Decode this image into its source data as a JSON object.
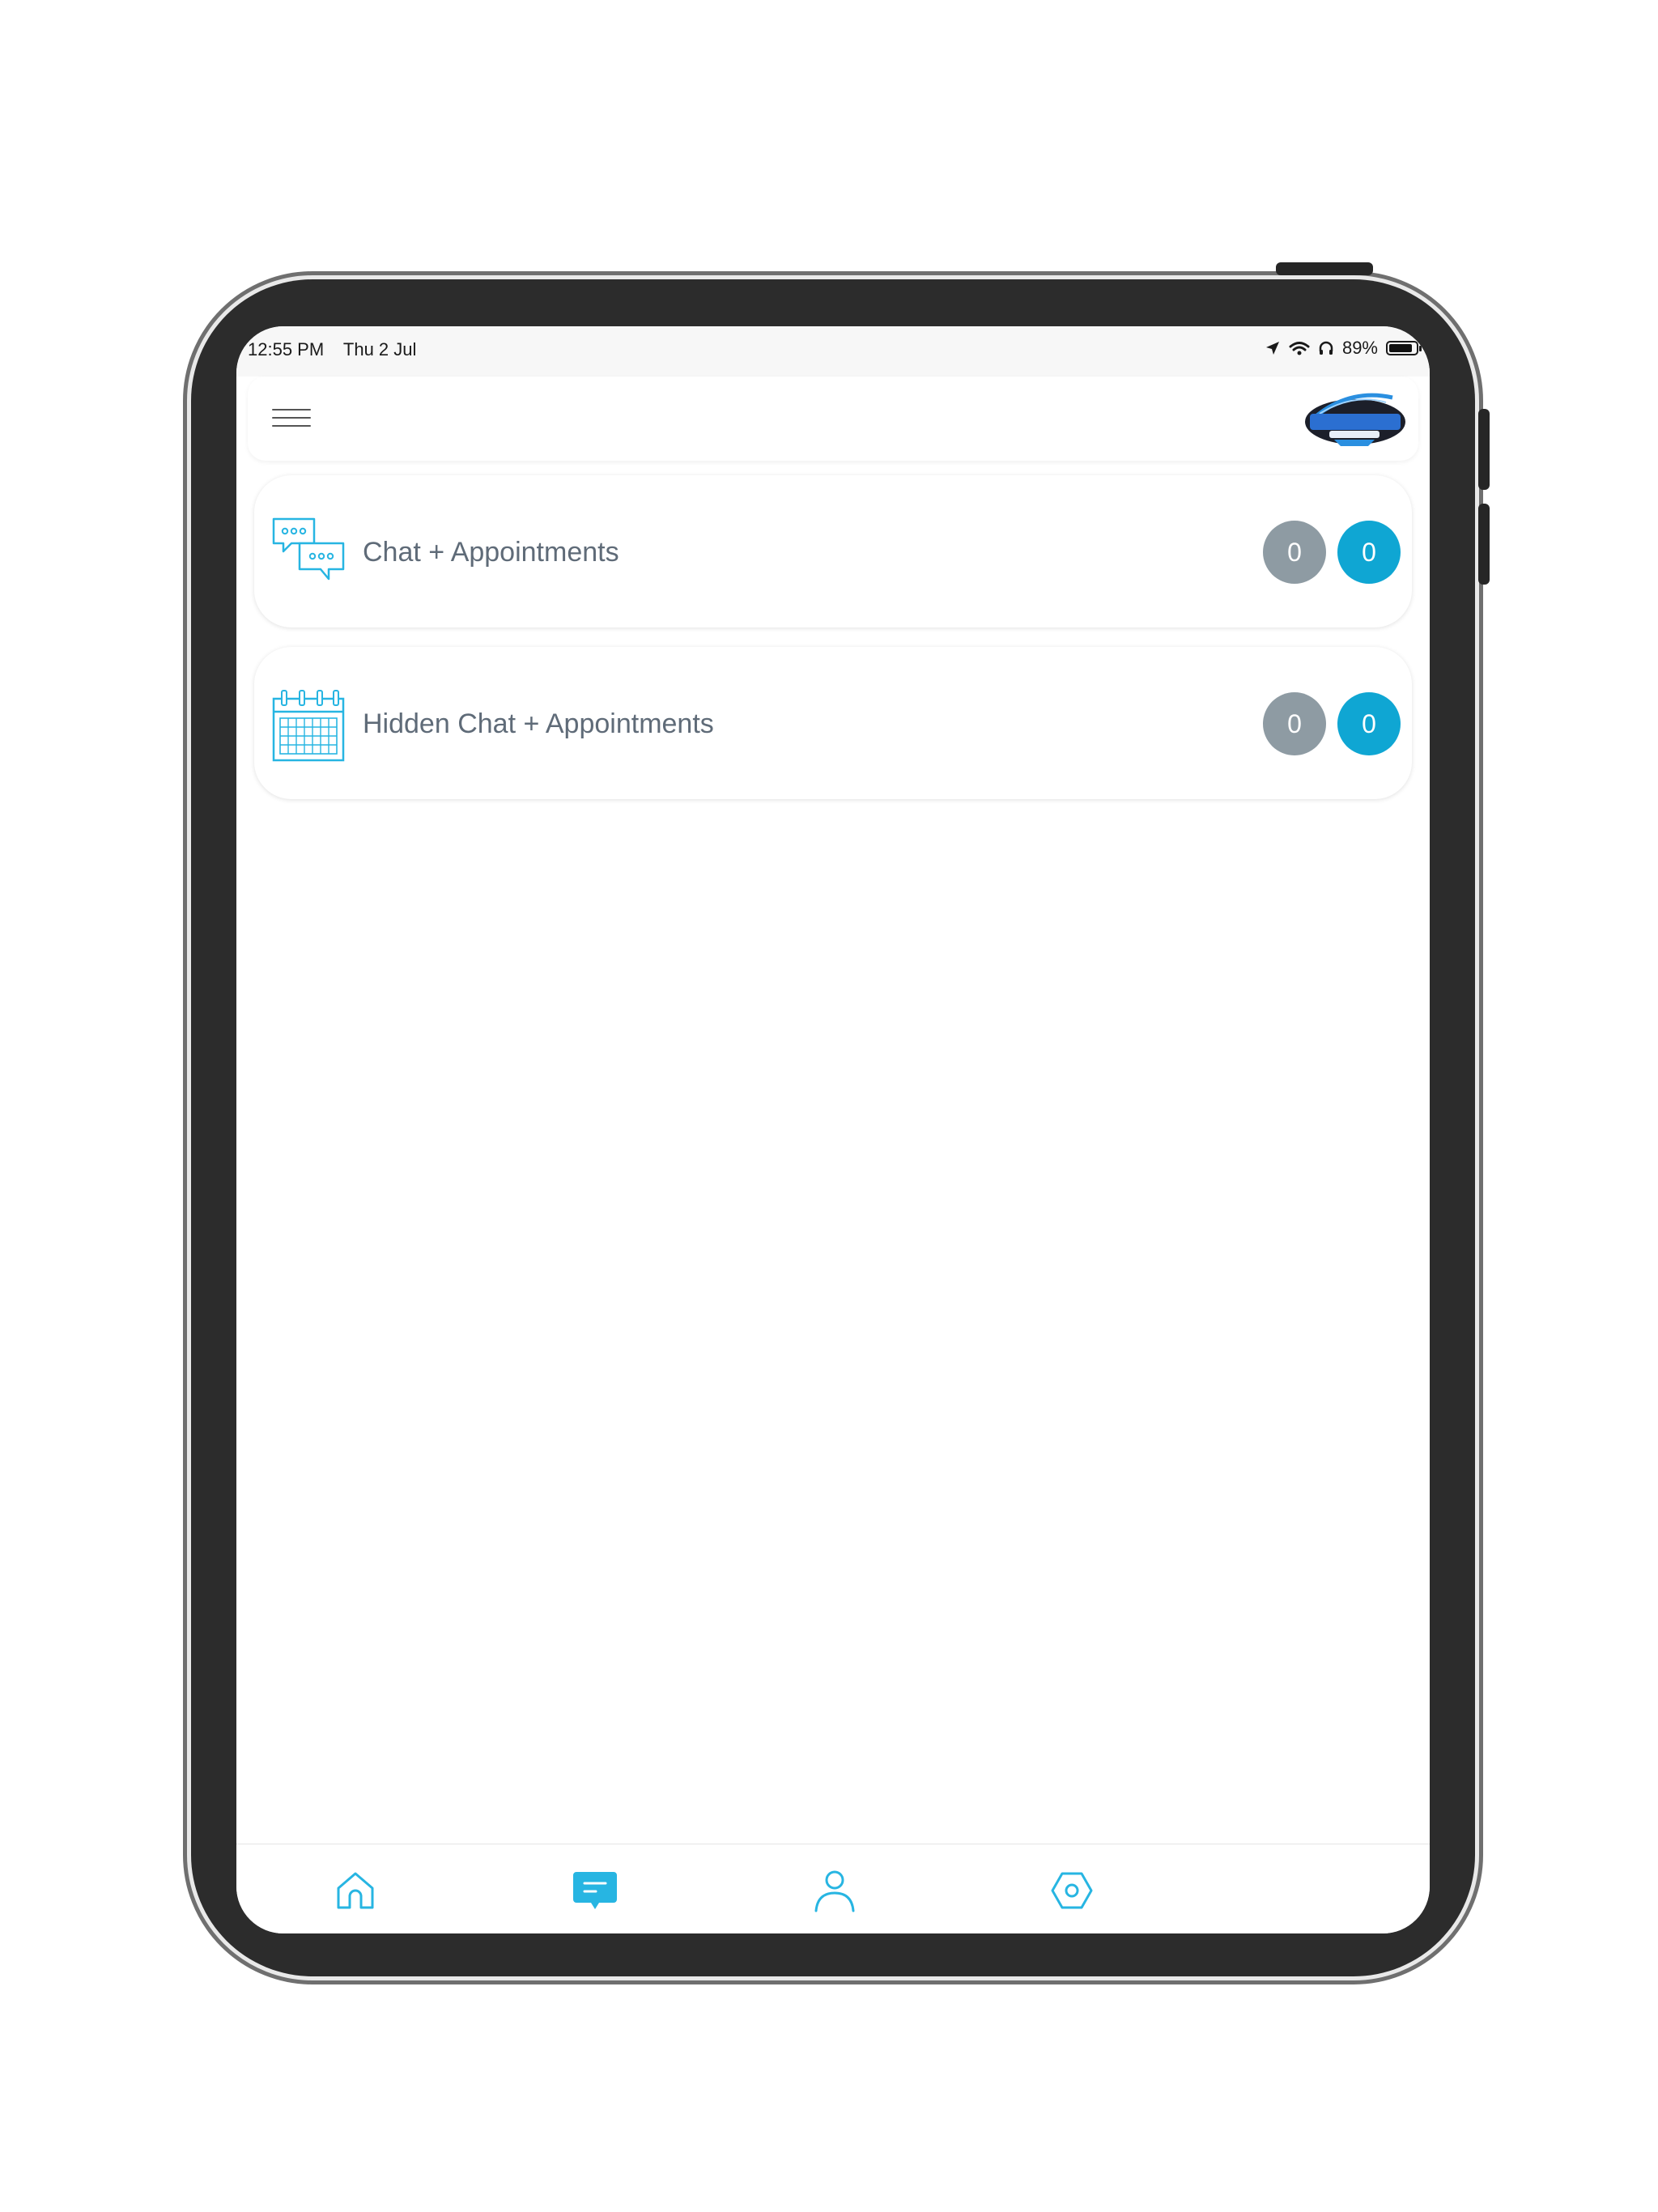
{
  "status_bar": {
    "time": "12:55 PM",
    "date": "Thu 2 Jul",
    "battery": "89%",
    "battery_level": 0.89
  },
  "header": {
    "menu_icon": "hamburger-menu-icon",
    "logo_icon": "clearway-automotive-logo"
  },
  "items": [
    {
      "label": "Chat + Appointments",
      "icon": "chat-bubbles-icon",
      "count_grey": "0",
      "count_blue": "0"
    },
    {
      "label": "Hidden Chat + Appointments",
      "icon": "calendar-icon",
      "count_grey": "0",
      "count_blue": "0"
    }
  ],
  "tabs": [
    {
      "icon": "home-icon",
      "active": false
    },
    {
      "icon": "chat-icon",
      "active": true
    },
    {
      "icon": "profile-icon",
      "active": false
    },
    {
      "icon": "settings-icon",
      "active": false
    }
  ],
  "colors": {
    "accent": "#0fa6d3",
    "icon_line": "#27b5e2",
    "badge_grey": "#8e9ba3",
    "label_text": "#5f6b78",
    "device_frame": "#2c2c2c"
  }
}
